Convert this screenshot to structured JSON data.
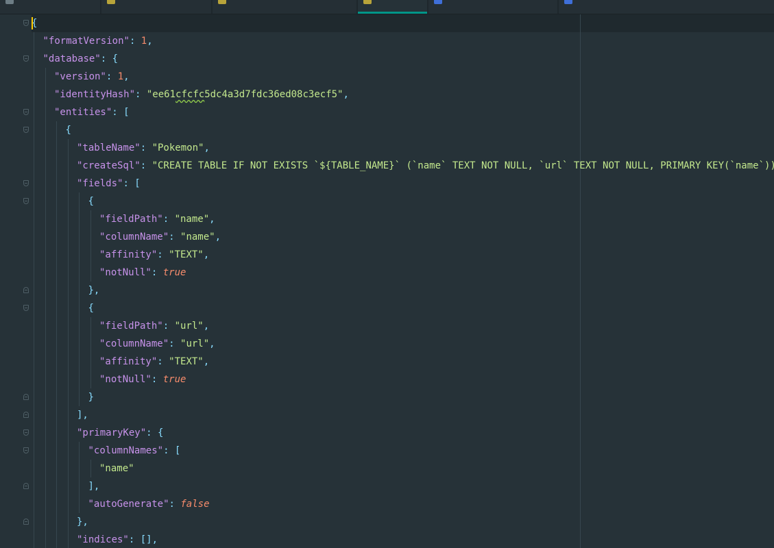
{
  "colors": {
    "background": "#263238",
    "key": "#c792ea",
    "string": "#c3e88d",
    "number": "#f78c6c",
    "punctuation": "#89ddff",
    "active_tab_accent": "#009688"
  },
  "tabs": [
    {
      "label": "",
      "icon": "file-icon",
      "active": false
    },
    {
      "label": "",
      "icon": "json-file-icon",
      "active": false
    },
    {
      "label": "",
      "icon": "json-file-icon",
      "active": false
    },
    {
      "label": "",
      "icon": "json-file-icon",
      "active": true
    },
    {
      "label": "",
      "icon": "kotlin-file-icon",
      "active": false
    },
    {
      "label": "",
      "icon": "kotlin-file-icon",
      "active": false
    }
  ],
  "editor": {
    "language": "json",
    "lines": [
      {
        "indent": 0,
        "tokens": [
          {
            "t": "p",
            "v": "{"
          }
        ]
      },
      {
        "indent": 1,
        "tokens": [
          {
            "t": "k",
            "v": "\"formatVersion\""
          },
          {
            "t": "p",
            "v": ": "
          },
          {
            "t": "n",
            "v": "1"
          },
          {
            "t": "p",
            "v": ","
          }
        ]
      },
      {
        "indent": 1,
        "tokens": [
          {
            "t": "k",
            "v": "\"database\""
          },
          {
            "t": "p",
            "v": ": {"
          }
        ]
      },
      {
        "indent": 2,
        "tokens": [
          {
            "t": "k",
            "v": "\"version\""
          },
          {
            "t": "p",
            "v": ": "
          },
          {
            "t": "n",
            "v": "1"
          },
          {
            "t": "p",
            "v": ","
          }
        ]
      },
      {
        "indent": 2,
        "tokens": [
          {
            "t": "k",
            "v": "\"identityHash\""
          },
          {
            "t": "p",
            "v": ": "
          },
          {
            "t": "s",
            "v": "\"ee61"
          },
          {
            "t": "s typo",
            "v": "cfcfc"
          },
          {
            "t": "s",
            "v": "5dc4a3d7fdc36ed08c3ecf5\""
          },
          {
            "t": "p",
            "v": ","
          }
        ]
      },
      {
        "indent": 2,
        "tokens": [
          {
            "t": "k",
            "v": "\"entities\""
          },
          {
            "t": "p",
            "v": ": ["
          }
        ]
      },
      {
        "indent": 3,
        "tokens": [
          {
            "t": "p",
            "v": "{"
          }
        ]
      },
      {
        "indent": 4,
        "tokens": [
          {
            "t": "k",
            "v": "\"tableName\""
          },
          {
            "t": "p",
            "v": ": "
          },
          {
            "t": "s",
            "v": "\"Pokemon\""
          },
          {
            "t": "p",
            "v": ","
          }
        ]
      },
      {
        "indent": 4,
        "tokens": [
          {
            "t": "k",
            "v": "\"createSql\""
          },
          {
            "t": "p",
            "v": ": "
          },
          {
            "t": "s",
            "v": "\"CREATE TABLE IF NOT EXISTS `${TABLE_NAME}` (`name` TEXT NOT NULL, `url` TEXT NOT NULL, PRIMARY KEY(`name`))\""
          },
          {
            "t": "p",
            "v": ","
          }
        ]
      },
      {
        "indent": 4,
        "tokens": [
          {
            "t": "k",
            "v": "\"fields\""
          },
          {
            "t": "p",
            "v": ": ["
          }
        ]
      },
      {
        "indent": 5,
        "tokens": [
          {
            "t": "p",
            "v": "{"
          }
        ]
      },
      {
        "indent": 6,
        "tokens": [
          {
            "t": "k",
            "v": "\"fieldPath\""
          },
          {
            "t": "p",
            "v": ": "
          },
          {
            "t": "s",
            "v": "\"name\""
          },
          {
            "t": "p",
            "v": ","
          }
        ]
      },
      {
        "indent": 6,
        "tokens": [
          {
            "t": "k",
            "v": "\"columnName\""
          },
          {
            "t": "p",
            "v": ": "
          },
          {
            "t": "s",
            "v": "\"name\""
          },
          {
            "t": "p",
            "v": ","
          }
        ]
      },
      {
        "indent": 6,
        "tokens": [
          {
            "t": "k",
            "v": "\"affinity\""
          },
          {
            "t": "p",
            "v": ": "
          },
          {
            "t": "s",
            "v": "\"TEXT\""
          },
          {
            "t": "p",
            "v": ","
          }
        ]
      },
      {
        "indent": 6,
        "tokens": [
          {
            "t": "k",
            "v": "\"notNull\""
          },
          {
            "t": "p",
            "v": ": "
          },
          {
            "t": "b",
            "v": "true"
          }
        ]
      },
      {
        "indent": 5,
        "tokens": [
          {
            "t": "p",
            "v": "},"
          }
        ]
      },
      {
        "indent": 5,
        "tokens": [
          {
            "t": "p",
            "v": "{"
          }
        ]
      },
      {
        "indent": 6,
        "tokens": [
          {
            "t": "k",
            "v": "\"fieldPath\""
          },
          {
            "t": "p",
            "v": ": "
          },
          {
            "t": "s",
            "v": "\"url\""
          },
          {
            "t": "p",
            "v": ","
          }
        ]
      },
      {
        "indent": 6,
        "tokens": [
          {
            "t": "k",
            "v": "\"columnName\""
          },
          {
            "t": "p",
            "v": ": "
          },
          {
            "t": "s",
            "v": "\"url\""
          },
          {
            "t": "p",
            "v": ","
          }
        ]
      },
      {
        "indent": 6,
        "tokens": [
          {
            "t": "k",
            "v": "\"affinity\""
          },
          {
            "t": "p",
            "v": ": "
          },
          {
            "t": "s",
            "v": "\"TEXT\""
          },
          {
            "t": "p",
            "v": ","
          }
        ]
      },
      {
        "indent": 6,
        "tokens": [
          {
            "t": "k",
            "v": "\"notNull\""
          },
          {
            "t": "p",
            "v": ": "
          },
          {
            "t": "b",
            "v": "true"
          }
        ]
      },
      {
        "indent": 5,
        "tokens": [
          {
            "t": "p",
            "v": "}"
          }
        ]
      },
      {
        "indent": 4,
        "tokens": [
          {
            "t": "p",
            "v": "],"
          }
        ]
      },
      {
        "indent": 4,
        "tokens": [
          {
            "t": "k",
            "v": "\"primaryKey\""
          },
          {
            "t": "p",
            "v": ": {"
          }
        ]
      },
      {
        "indent": 5,
        "tokens": [
          {
            "t": "k",
            "v": "\"columnNames\""
          },
          {
            "t": "p",
            "v": ": ["
          }
        ]
      },
      {
        "indent": 6,
        "tokens": [
          {
            "t": "s",
            "v": "\"name\""
          }
        ]
      },
      {
        "indent": 5,
        "tokens": [
          {
            "t": "p",
            "v": "],"
          }
        ]
      },
      {
        "indent": 5,
        "tokens": [
          {
            "t": "k",
            "v": "\"autoGenerate\""
          },
          {
            "t": "p",
            "v": ": "
          },
          {
            "t": "b",
            "v": "false"
          }
        ]
      },
      {
        "indent": 4,
        "tokens": [
          {
            "t": "p",
            "v": "},"
          }
        ]
      },
      {
        "indent": 4,
        "tokens": [
          {
            "t": "k",
            "v": "\"indices\""
          },
          {
            "t": "p",
            "v": ": "
          },
          {
            "t": "p",
            "v": "[],"
          }
        ]
      }
    ]
  }
}
